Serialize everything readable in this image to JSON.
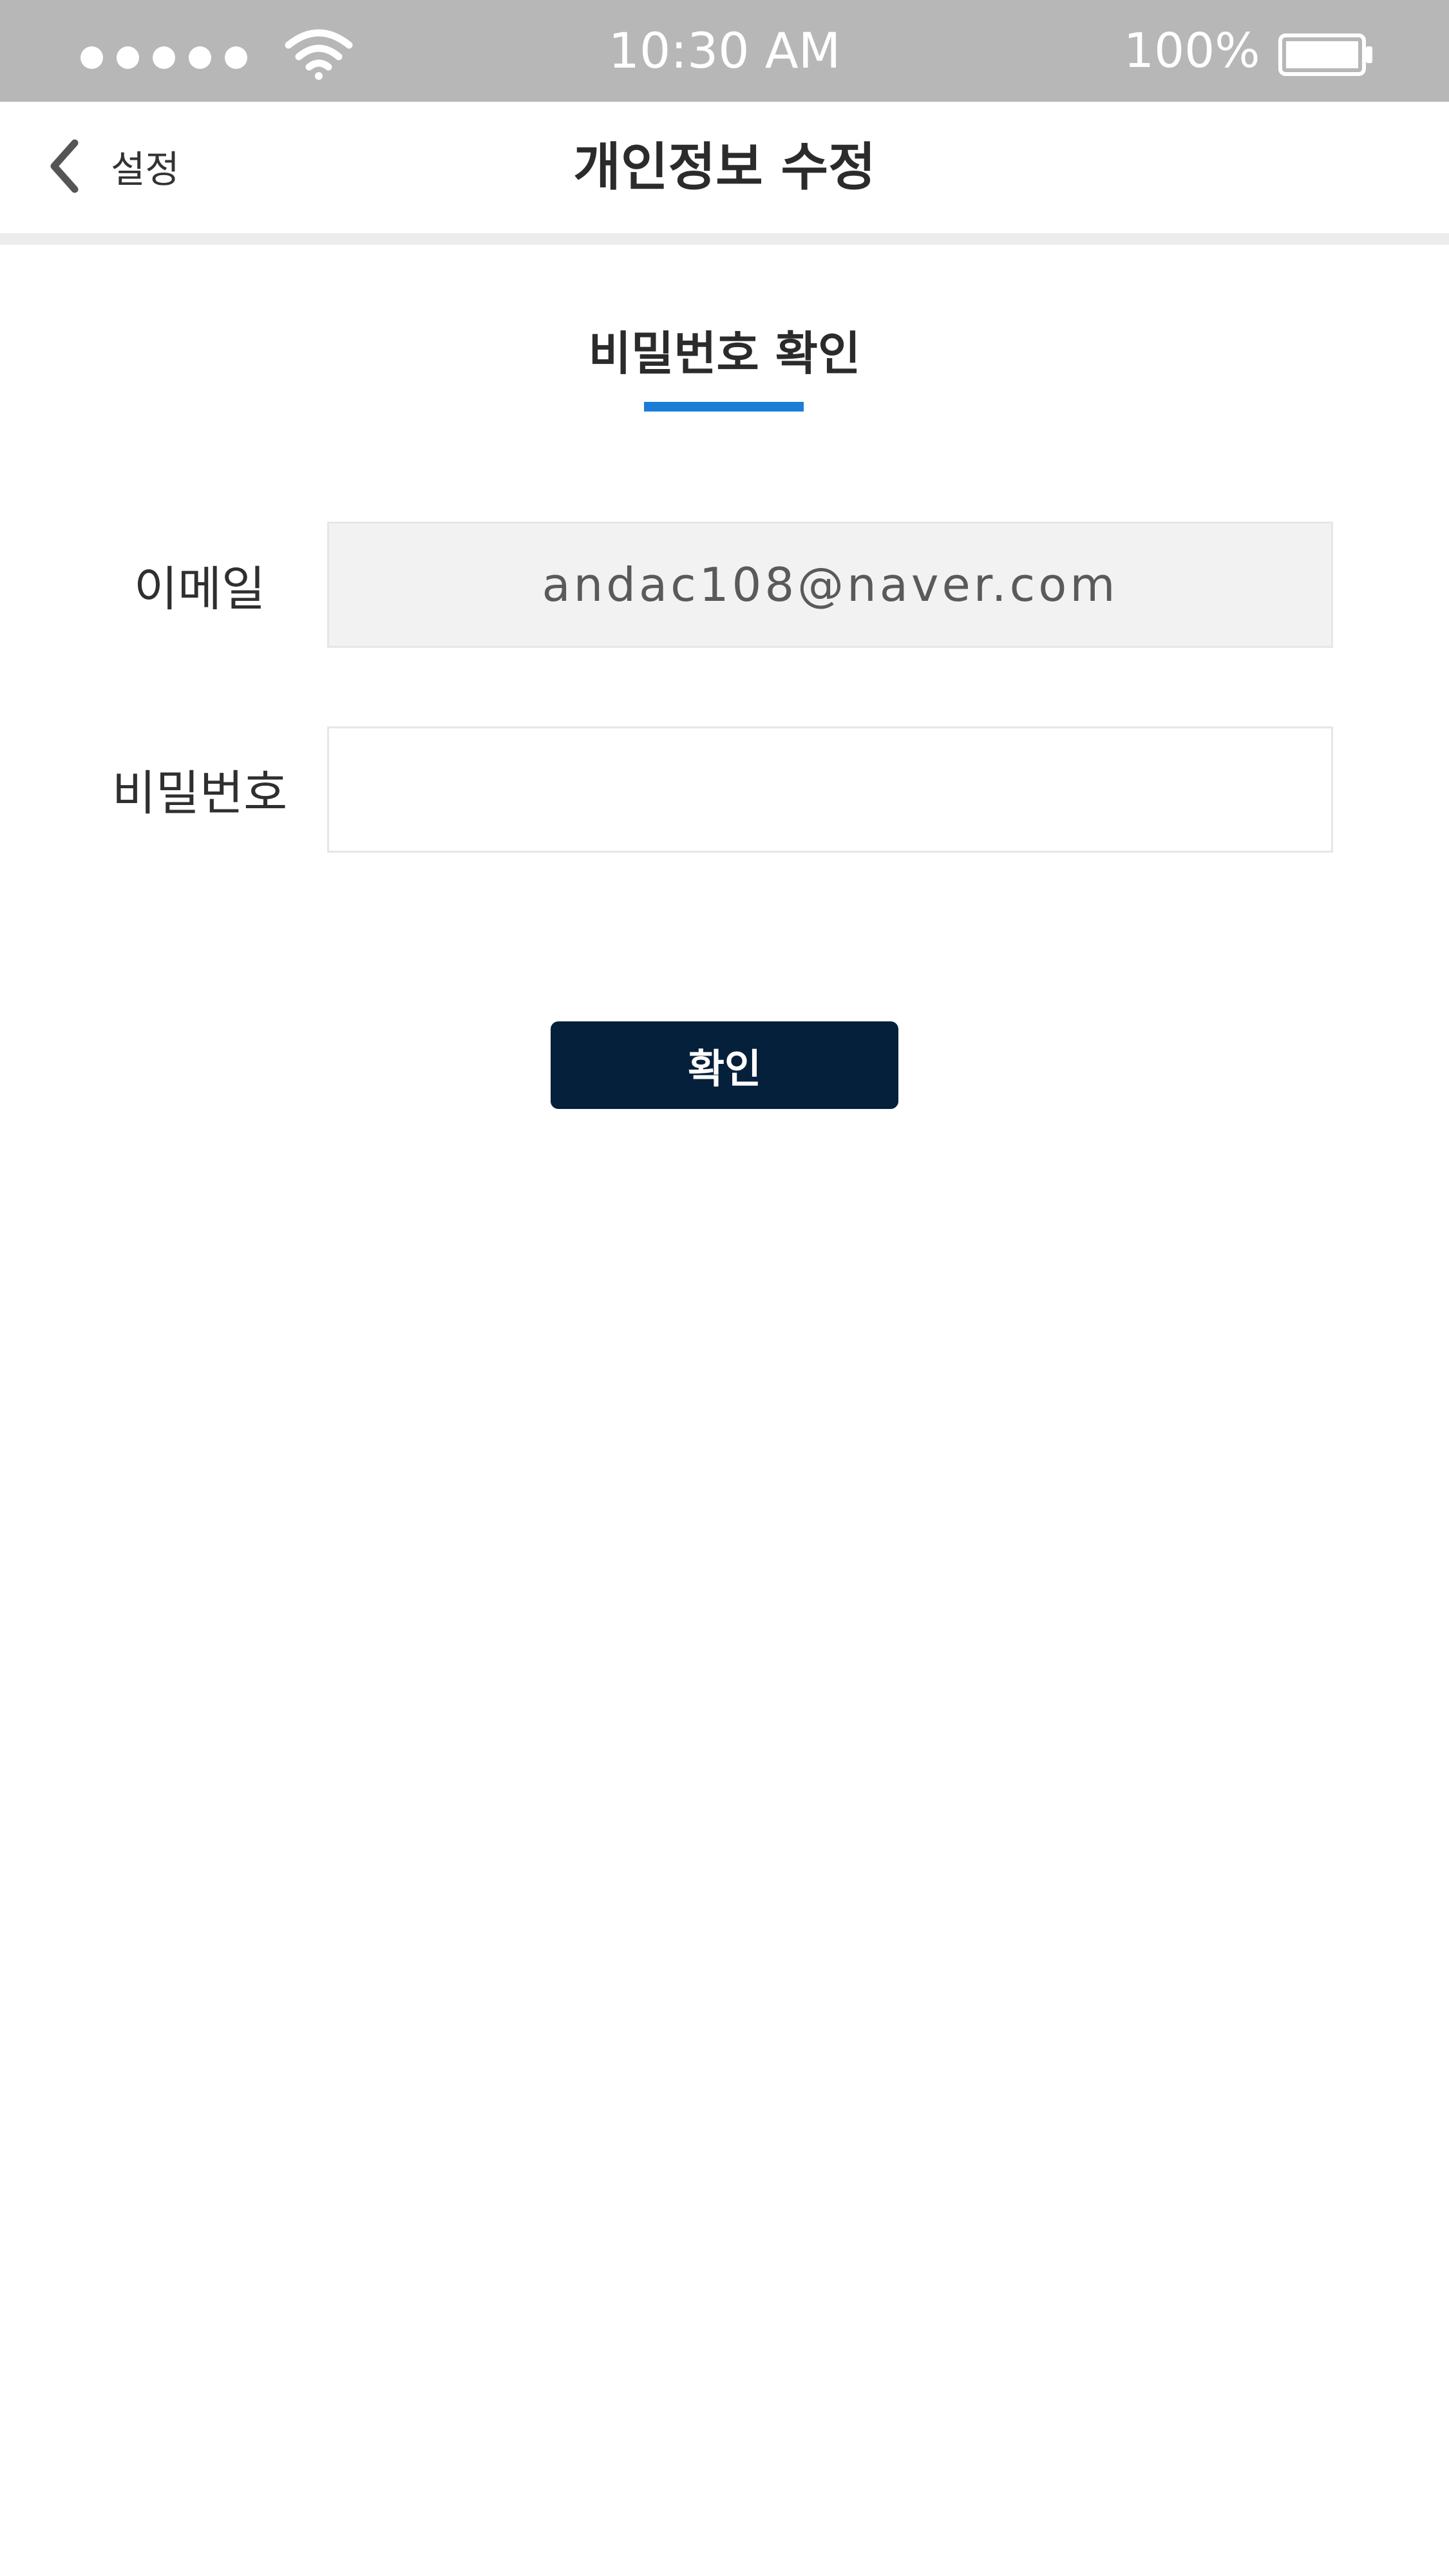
{
  "status_bar": {
    "time": "10:30 AM",
    "battery_percent": "100%",
    "signal_icon": "signal-dots-icon",
    "wifi_icon": "wifi-icon",
    "battery_icon": "battery-icon",
    "battery_level": 1.0
  },
  "nav": {
    "back_label": "설정",
    "back_icon": "chevron-left-icon",
    "title": "개인정보 수정"
  },
  "section": {
    "title": "비밀번호 확인",
    "accent_color": "#1a7ed7"
  },
  "form": {
    "email_label": "이메일",
    "email_value": "andac108@naver.com",
    "password_label": "비밀번호",
    "password_value": ""
  },
  "actions": {
    "confirm_label": "확인",
    "confirm_color": "#04203a"
  }
}
